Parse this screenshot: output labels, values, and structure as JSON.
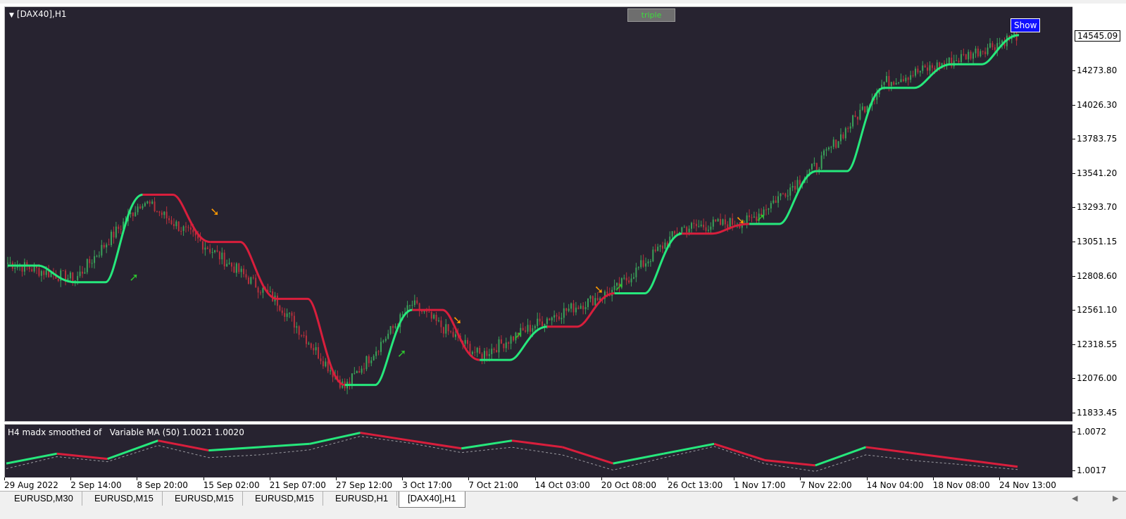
{
  "chart": {
    "symbol_title": "[DAX40],H1",
    "triple_label": "triple",
    "show_label": "Show",
    "current_price": "14545.09",
    "price_axis": [
      "14273.80",
      "14026.30",
      "13783.75",
      "13541.20",
      "13293.70",
      "13051.15",
      "12808.60",
      "12561.10",
      "12318.55",
      "12076.00",
      "11833.45"
    ],
    "time_axis": [
      "29 Aug 2022",
      "2 Sep 14:00",
      "8 Sep 20:00",
      "15 Sep 02:00",
      "21 Sep 07:00",
      "27 Sep 12:00",
      "3 Oct 17:00",
      "7 Oct 21:00",
      "14 Oct 03:00",
      "20 Oct 08:00",
      "26 Oct 13:00",
      "1 Nov 17:00",
      "7 Nov 22:00",
      "14 Nov 04:00",
      "18 Nov 08:00",
      "24 Nov 13:00"
    ]
  },
  "indicator": {
    "title": "H4 madx smoothed of   Variable MA (50) 1.0021 1.0020",
    "axis": [
      "1.0072",
      "1.0017"
    ]
  },
  "colors": {
    "background": "#272330",
    "up_color": "#26e87c",
    "down_color": "#d81e3c",
    "arrow_up": "#2ec42e",
    "arrow_down": "#ff9a00"
  },
  "tabs": [
    {
      "label": "EURUSD,M30",
      "active": false
    },
    {
      "label": "EURUSD,M15",
      "active": false
    },
    {
      "label": "EURUSD,M15",
      "active": false
    },
    {
      "label": "EURUSD,M15",
      "active": false
    },
    {
      "label": "EURUSD,H1",
      "active": false
    },
    {
      "label": "[DAX40],H1",
      "active": true
    }
  ],
  "chart_data": {
    "type": "line",
    "title": "[DAX40],H1",
    "ylim": [
      11800,
      14600
    ],
    "price_series": [
      {
        "x": "29 Aug 2022",
        "y": 12900
      },
      {
        "x": "2 Sep 14:00",
        "y": 12780
      },
      {
        "x": "8 Sep 20:00",
        "y": 13350
      },
      {
        "x": "15 Sep 02:00",
        "y": 13000
      },
      {
        "x": "21 Sep 07:00",
        "y": 12620
      },
      {
        "x": "27 Sep 12:00",
        "y": 12000
      },
      {
        "x": "3 Oct 17:00",
        "y": 12600
      },
      {
        "x": "7 Oct 21:00",
        "y": 12230
      },
      {
        "x": "14 Oct 03:00",
        "y": 12500
      },
      {
        "x": "20 Oct 08:00",
        "y": 12700
      },
      {
        "x": "26 Oct 13:00",
        "y": 13150
      },
      {
        "x": "1 Nov 17:00",
        "y": 13200
      },
      {
        "x": "7 Nov 22:00",
        "y": 13600
      },
      {
        "x": "14 Nov 04:00",
        "y": 14200
      },
      {
        "x": "18 Nov 08:00",
        "y": 14350
      },
      {
        "x": "24 Nov 13:00",
        "y": 14545
      }
    ],
    "ma_series": [
      {
        "x": "29 Aug 2022",
        "y": 12880,
        "trend": "down"
      },
      {
        "x": "2 Sep 14:00",
        "y": 12760,
        "trend": "up"
      },
      {
        "x": "8 Sep 20:00",
        "y": 13390,
        "trend": "up"
      },
      {
        "x": "15 Sep 02:00",
        "y": 13050,
        "trend": "down"
      },
      {
        "x": "21 Sep 07:00",
        "y": 12640,
        "trend": "down"
      },
      {
        "x": "27 Sep 12:00",
        "y": 12020,
        "trend": "down"
      },
      {
        "x": "3 Oct 17:00",
        "y": 12560,
        "trend": "up"
      },
      {
        "x": "7 Oct 21:00",
        "y": 12200,
        "trend": "down"
      },
      {
        "x": "14 Oct 03:00",
        "y": 12440,
        "trend": "up"
      },
      {
        "x": "20 Oct 08:00",
        "y": 12680,
        "trend": "down"
      },
      {
        "x": "26 Oct 13:00",
        "y": 13110,
        "trend": "up"
      },
      {
        "x": "1 Nov 17:00",
        "y": 13180,
        "trend": "down"
      },
      {
        "x": "7 Nov 22:00",
        "y": 13560,
        "trend": "up"
      },
      {
        "x": "14 Nov 04:00",
        "y": 14160,
        "trend": "up"
      },
      {
        "x": "18 Nov 08:00",
        "y": 14330,
        "trend": "up"
      },
      {
        "x": "24 Nov 13:00",
        "y": 14540,
        "trend": "up"
      }
    ],
    "signals": [
      {
        "x": "2 Sep 14:00",
        "y": 12770,
        "type": "buy"
      },
      {
        "x": "11 Sep 12:00",
        "y": 13240,
        "type": "sell"
      },
      {
        "x": "3 Oct 17:00",
        "y": 12220,
        "type": "buy"
      },
      {
        "x": "7 Oct 09:00",
        "y": 12460,
        "type": "sell"
      },
      {
        "x": "14 Oct 03:00",
        "y": 12350,
        "type": "buy"
      },
      {
        "x": "20 Oct 04:00",
        "y": 12680,
        "type": "sell"
      },
      {
        "x": "20 Oct 18:00",
        "y": 12700,
        "type": "buy"
      },
      {
        "x": "1 Nov 17:00",
        "y": 13180,
        "type": "sell"
      },
      {
        "x": "3 Nov 00:00",
        "y": 13200,
        "type": "buy"
      }
    ],
    "indicator_series": [
      1.0025,
      1.004,
      1.0032,
      1.006,
      1.0045,
      1.005,
      1.0055,
      1.0072,
      1.006,
      1.0048,
      1.006,
      1.005,
      1.0025,
      1.004,
      1.0055,
      1.003,
      1.0022,
      1.005,
      1.004,
      1.003,
      1.002
    ]
  }
}
